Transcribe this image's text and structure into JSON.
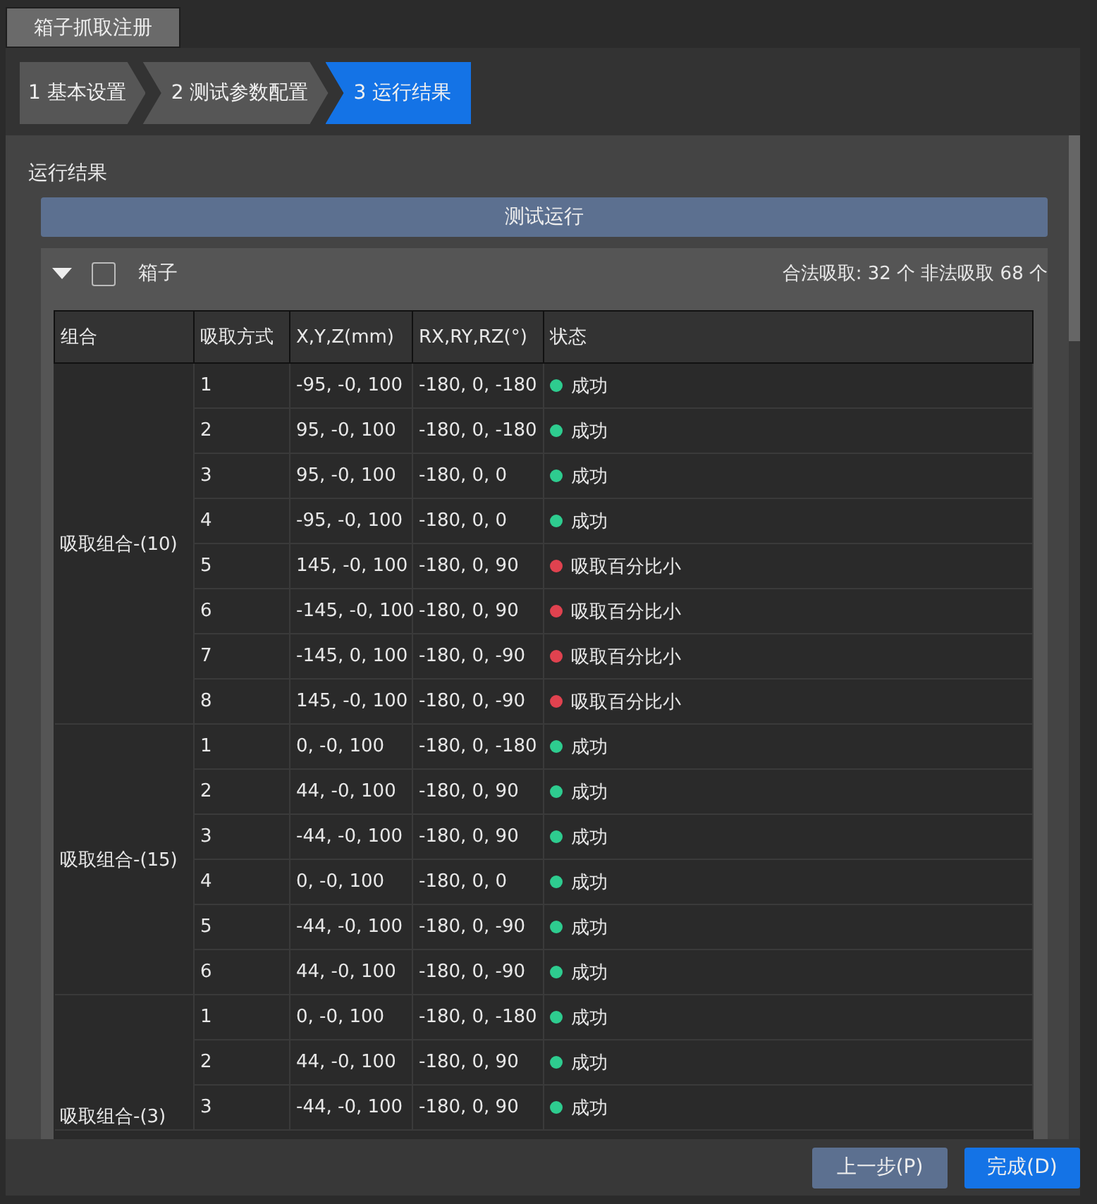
{
  "window": {
    "tab": "箱子抓取注册"
  },
  "steps": [
    {
      "label": "1 基本设置",
      "selected": false
    },
    {
      "label": "2 测试参数配置",
      "selected": false
    },
    {
      "label": "3 运行结果",
      "selected": true
    }
  ],
  "section_title": "运行结果",
  "run_button": "测试运行",
  "group": {
    "name": "箱子",
    "expanded": true,
    "checked": false,
    "summary": "合法吸取: 32 个 非法吸取 68 个"
  },
  "table": {
    "columns": [
      "组合",
      "吸取方式",
      "X,Y,Z(mm)",
      "RX,RY,RZ(°)",
      "状态"
    ],
    "groups": [
      {
        "name": "吸取组合-(10)",
        "rows": [
          {
            "mode": "1",
            "xyz": "-95, -0, 100",
            "rxyz": "-180, 0, -180",
            "status": "成功",
            "color": "#2ecc8f"
          },
          {
            "mode": "2",
            "xyz": "95, -0, 100",
            "rxyz": "-180, 0, -180",
            "status": "成功",
            "color": "#2ecc8f"
          },
          {
            "mode": "3",
            "xyz": "95, -0, 100",
            "rxyz": "-180, 0, 0",
            "status": "成功",
            "color": "#2ecc8f"
          },
          {
            "mode": "4",
            "xyz": "-95, -0, 100",
            "rxyz": "-180, 0, 0",
            "status": "成功",
            "color": "#2ecc8f"
          },
          {
            "mode": "5",
            "xyz": "145, -0, 100",
            "rxyz": "-180, 0, 90",
            "status": "吸取百分比小",
            "color": "#e0424f"
          },
          {
            "mode": "6",
            "xyz": "-145, -0, 100",
            "rxyz": "-180, 0, 90",
            "status": "吸取百分比小",
            "color": "#e0424f"
          },
          {
            "mode": "7",
            "xyz": "-145, 0, 100",
            "rxyz": "-180, 0, -90",
            "status": "吸取百分比小",
            "color": "#e0424f"
          },
          {
            "mode": "8",
            "xyz": "145, -0, 100",
            "rxyz": "-180, 0, -90",
            "status": "吸取百分比小",
            "color": "#e0424f"
          }
        ]
      },
      {
        "name": "吸取组合-(15)",
        "rows": [
          {
            "mode": "1",
            "xyz": "0, -0, 100",
            "rxyz": "-180, 0, -180",
            "status": "成功",
            "color": "#2ecc8f"
          },
          {
            "mode": "2",
            "xyz": "44, -0, 100",
            "rxyz": "-180, 0, 90",
            "status": "成功",
            "color": "#2ecc8f"
          },
          {
            "mode": "3",
            "xyz": "-44, -0, 100",
            "rxyz": "-180, 0, 90",
            "status": "成功",
            "color": "#2ecc8f"
          },
          {
            "mode": "4",
            "xyz": "0, -0, 100",
            "rxyz": "-180, 0, 0",
            "status": "成功",
            "color": "#2ecc8f"
          },
          {
            "mode": "5",
            "xyz": "-44, -0, 100",
            "rxyz": "-180, 0, -90",
            "status": "成功",
            "color": "#2ecc8f"
          },
          {
            "mode": "6",
            "xyz": "44, -0, 100",
            "rxyz": "-180, 0, -90",
            "status": "成功",
            "color": "#2ecc8f"
          }
        ]
      },
      {
        "name": "吸取组合-(3)",
        "rows": [
          {
            "mode": "1",
            "xyz": "0, -0, 100",
            "rxyz": "-180, 0, -180",
            "status": "成功",
            "color": "#2ecc8f"
          },
          {
            "mode": "2",
            "xyz": "44, -0, 100",
            "rxyz": "-180, 0, 90",
            "status": "成功",
            "color": "#2ecc8f"
          },
          {
            "mode": "3",
            "xyz": "-44, -0, 100",
            "rxyz": "-180, 0, 90",
            "status": "成功",
            "color": "#2ecc8f"
          }
        ]
      }
    ]
  },
  "buttons": {
    "back": "上一步(P)",
    "finish": "完成(D)"
  }
}
